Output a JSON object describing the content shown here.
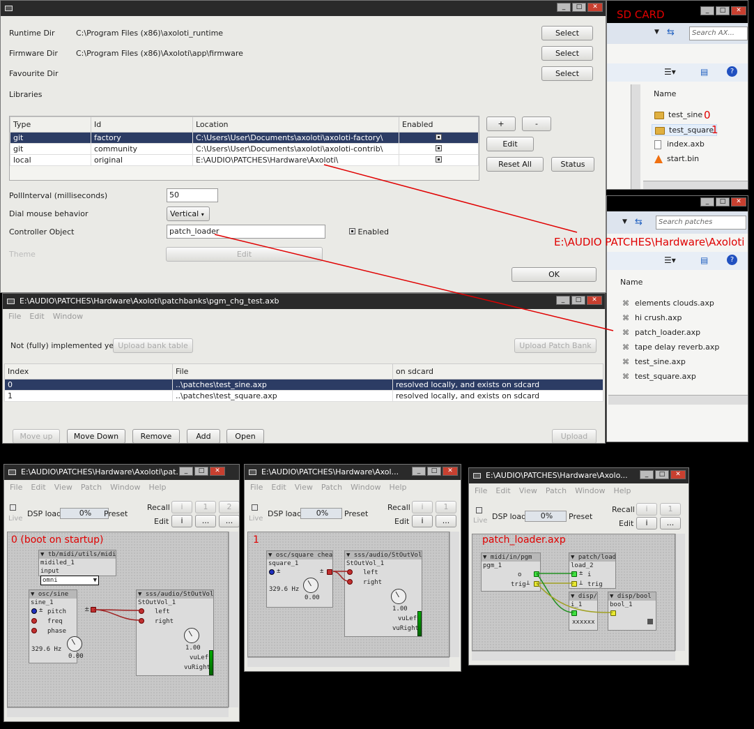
{
  "prefs": {
    "runtime_dir_label": "Runtime Dir",
    "runtime_dir_value": "C:\\Program Files (x86)\\axoloti_runtime",
    "firmware_dir_label": "Firmware Dir",
    "firmware_dir_value": "C:\\Program Files (x86)\\Axoloti\\app\\firmware",
    "favourite_dir_label": "Favourite Dir",
    "select_label": "Select",
    "libraries_label": "Libraries",
    "columns": [
      "Type",
      "Id",
      "Location",
      "Enabled"
    ],
    "rows": [
      {
        "type": "git",
        "id": "factory",
        "location": "C:\\Users\\User\\Documents\\axoloti\\axoloti-factory\\"
      },
      {
        "type": "git",
        "id": "community",
        "location": "C:\\Users\\User\\Documents\\axoloti\\axoloti-contrib\\"
      },
      {
        "type": "local",
        "id": "original",
        "location": "E:\\AUDIO\\PATCHES\\Hardware\\Axoloti\\"
      }
    ],
    "plus_label": "+",
    "minus_label": "-",
    "edit_label": "Edit",
    "reset_all_label": "Reset All",
    "status_label": "Status",
    "poll_label": "PollInterval (milliseconds)",
    "poll_value": "50",
    "dial_label": "Dial mouse behavior",
    "dial_value": "Vertical",
    "controller_label": "Controller Object",
    "controller_value": "patch_loader",
    "enabled_label": "Enabled",
    "theme_label": "Theme",
    "theme_edit_label": "Edit",
    "ok_label": "OK"
  },
  "annotations": {
    "sd_card": "SD CARD",
    "path": "E:\\AUDIO PATCHES\\Hardware\\Axoloti",
    "idx0": "0",
    "idx1": "1",
    "boot": "0   (boot on startup)",
    "one": "1",
    "patch_loader": "patch_loader.axp"
  },
  "explorer1": {
    "search_placeholder": "Search AX...",
    "name_header": "Name",
    "items": [
      "test_sine",
      "test_square",
      "index.axb",
      "start.bin"
    ]
  },
  "explorer2": {
    "search_placeholder": "Search patches",
    "name_header": "Name",
    "items": [
      "elements  clouds.axp",
      "hi  crush.axp",
      "patch_loader.axp",
      "tape  delay  reverb.axp",
      "test_sine.axp",
      "test_square.axp"
    ]
  },
  "bank": {
    "title": "E:\\AUDIO\\PATCHES\\Hardware\\Axoloti\\patchbanks\\pgm_chg_test.axb",
    "menu": [
      "File",
      "Edit",
      "Window"
    ],
    "not_impl": "Not (fully) implemented yet!",
    "upload_bank_table": "Upload bank table",
    "upload_patch_bank": "Upload Patch Bank",
    "columns": [
      "Index",
      "File",
      "on sdcard"
    ],
    "rows": [
      {
        "index": "0",
        "file": "..\\patches\\test_sine.axp",
        "status": "resolved locally, and exists on sdcard"
      },
      {
        "index": "1",
        "file": "..\\patches\\test_square.axp",
        "status": "resolved locally, and exists on sdcard"
      }
    ],
    "move_up": "Move up",
    "move_down": "Move Down",
    "remove": "Remove",
    "add": "Add",
    "open": "Open",
    "upload": "Upload"
  },
  "patch_common": {
    "menu": [
      "File",
      "Edit",
      "View",
      "Patch",
      "Window",
      "Help"
    ],
    "live": "Live",
    "dsp_load": "DSP load",
    "dsp_value": "0%",
    "preset": "Preset",
    "recall": "Recall",
    "edit": "Edit",
    "i": "i",
    "one": "1",
    "two": "2",
    "dots": "..."
  },
  "patch1": {
    "title": "E:\\AUDIO\\PATCHES\\Hardware\\Axoloti\\pat...",
    "midiled_hd": "tb/midi/utils/midiled",
    "midiled_nm": "midiled_1",
    "input_label": "input",
    "input_value": "omni",
    "sine_hd": "osc/sine",
    "sine_nm": "sine_1",
    "pitch": "pitch",
    "freq": "freq",
    "phase": "phase",
    "hz": "329.6 Hz",
    "knob_val": "0.00",
    "out_hd": "sss/audio/StOutVol",
    "out_nm": "StOutVol_1",
    "left": "left",
    "right": "right",
    "vol": "1.00",
    "vul": "vuLeft",
    "vur": "vuRight"
  },
  "patch2": {
    "title": "E:\\AUDIO\\PATCHES\\Hardware\\Axol...",
    "sq_hd": "osc/square cheap",
    "sq_nm": "square_1",
    "hz": "329.6 Hz",
    "knob_val": "0.00",
    "out_hd": "sss/audio/StOutVol",
    "out_nm": "StOutVol_1",
    "left": "left",
    "right": "right",
    "vol": "1.00",
    "vul": "vuLeft",
    "vur": "vuRight"
  },
  "patch3": {
    "title": "E:\\AUDIO\\PATCHES\\Hardware\\Axolo...",
    "pgm_hd": "midi/in/pgm",
    "pgm_nm": "pgm_1",
    "o": "o",
    "trig": "trig",
    "load_hd": "patch/load i",
    "load_nm": "load_2",
    "i_in": "i",
    "trig_in": "trig",
    "dispi_hd": "disp/i",
    "dispi_nm": "i_1",
    "dispi_val": "xxxxxx",
    "bool_hd": "disp/bool",
    "bool_nm": "bool_1"
  }
}
